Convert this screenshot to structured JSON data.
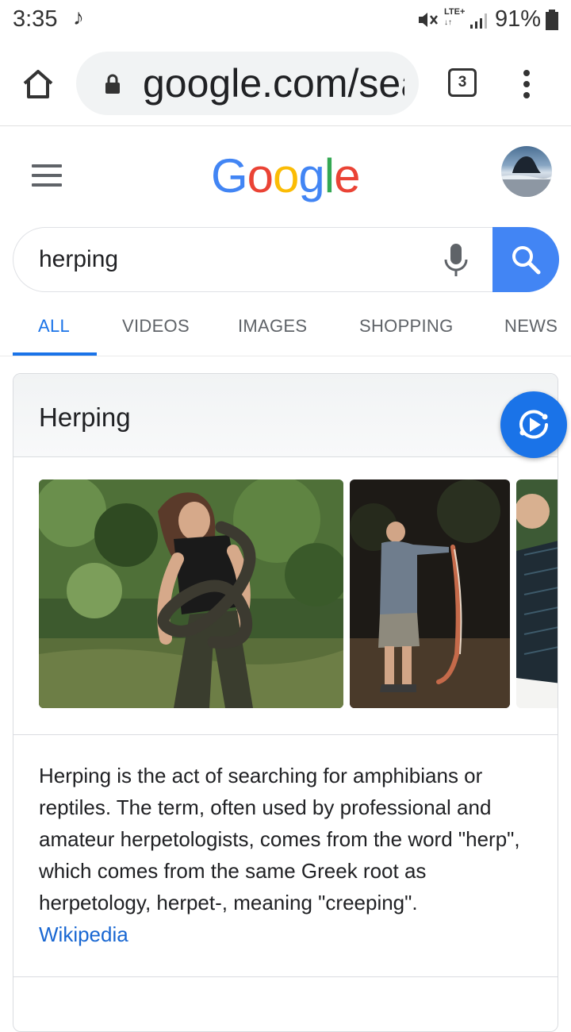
{
  "status_bar": {
    "time": "3:35",
    "note_icon": "music-note-icon",
    "network": "LTE+",
    "battery": "91%"
  },
  "browser": {
    "url": "google.com/search",
    "tab_count": "3"
  },
  "google": {
    "logo_letters": [
      "G",
      "o",
      "o",
      "g",
      "l",
      "e"
    ],
    "logo_colors": [
      "#4285f4",
      "#ea4335",
      "#fbbc05",
      "#4285f4",
      "#34a853",
      "#ea4335"
    ]
  },
  "search": {
    "query": "herping"
  },
  "tabs": [
    "ALL",
    "VIDEOS",
    "IMAGES",
    "SHOPPING",
    "NEWS"
  ],
  "knowledge_panel": {
    "title": "Herping",
    "description": "Herping is the act of searching for amphibians or reptiles. The term, often used by professional and amateur herpetologists, comes from the word \"herp\", which comes from the same Greek root as herpetology, herpet-, meaning \"creeping\".",
    "source_link": "Wikipedia"
  },
  "colors": {
    "accent_blue": "#1a73e8",
    "search_button": "#4285f4",
    "link": "#1967d2"
  }
}
